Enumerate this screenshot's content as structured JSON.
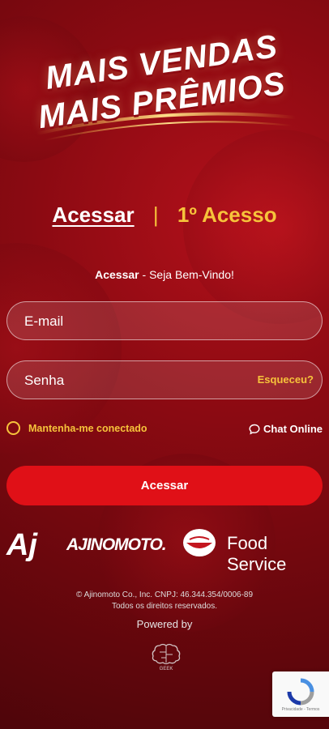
{
  "hero": {
    "line1": "MAIS VENDAS",
    "line2": "MAIS PRÊMIOS"
  },
  "tabs": {
    "access": "Acessar",
    "separator": "|",
    "first_access": "1º Acesso"
  },
  "welcome": {
    "bold": "Acessar",
    "rest": " - Seja Bem-Vindo!"
  },
  "form": {
    "email_placeholder": "E-mail",
    "password_placeholder": "Senha",
    "forgot_label": "Esqueceu?",
    "keep_connected_label": "Mantenha-me conectado",
    "chat_label": "Chat Online",
    "submit_label": "Acessar"
  },
  "brands": {
    "aj_mark": "Aj",
    "ajinomoto": "AJINOMOTO.",
    "food_service": "Food Service"
  },
  "footer": {
    "copyright": "© Ajinomoto Co., Inc. CNPJ: 46.344.354/0006-89",
    "rights": "Todos os direitos reservados.",
    "powered_by": "Powered by",
    "powered_logo": "GEEK"
  },
  "recaptcha": {
    "text": "Privacidade - Termos"
  },
  "colors": {
    "accent": "#f6c33b",
    "button": "#e01017",
    "background": "#8b0a12"
  }
}
